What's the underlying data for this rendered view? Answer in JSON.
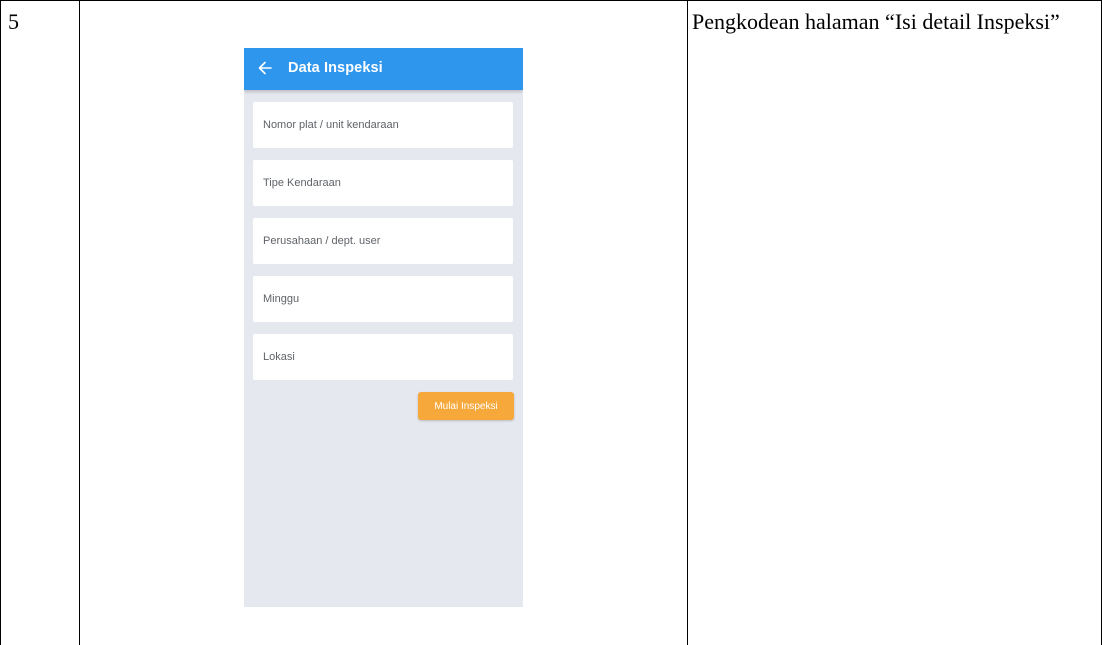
{
  "row": {
    "number": "5",
    "description": "Pengkodean halaman “Isi detail Inspeksi”"
  },
  "phone": {
    "app_bar": {
      "title": "Data Inspeksi",
      "back_icon": "arrow-left-icon",
      "color": "#2f96ee"
    },
    "fields": [
      {
        "placeholder": "Nomor plat / unit kendaraan",
        "value": ""
      },
      {
        "placeholder": "Tipe Kendaraan",
        "value": ""
      },
      {
        "placeholder": "Perusahaan / dept. user",
        "value": ""
      },
      {
        "placeholder": "Minggu",
        "value": ""
      },
      {
        "placeholder": "Lokasi",
        "value": ""
      }
    ],
    "button": {
      "label": "Mulai Inspeksi",
      "color": "#f6a83a"
    },
    "background": "#e6e8f0"
  }
}
